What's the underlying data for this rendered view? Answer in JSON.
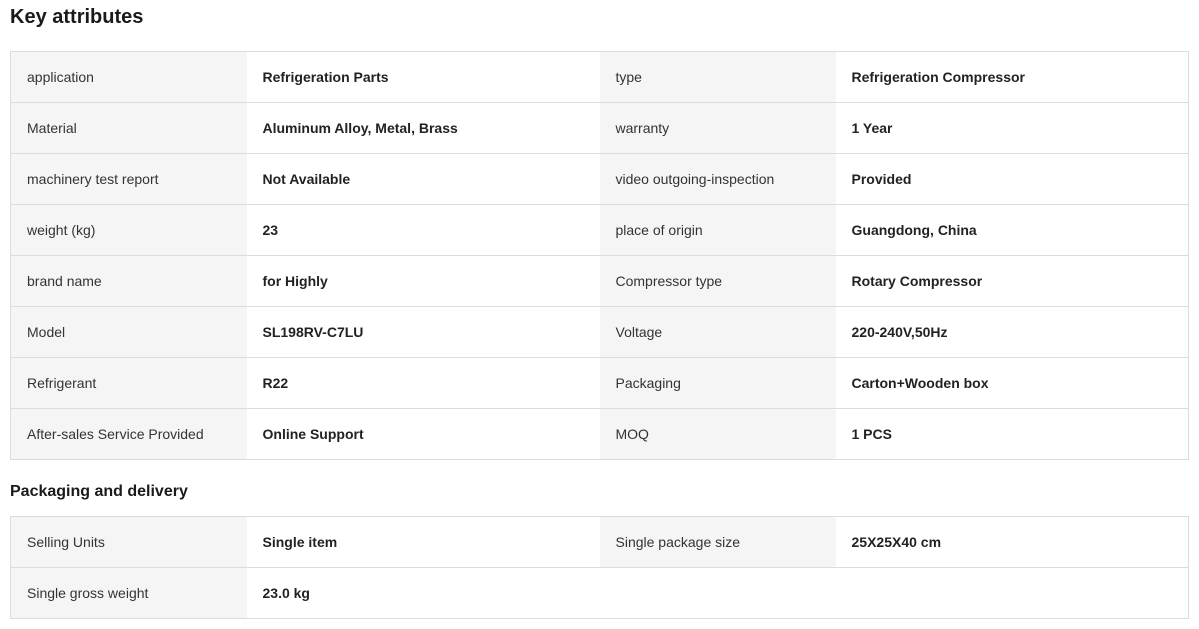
{
  "key_attributes": {
    "title": "Key attributes",
    "rows": [
      [
        {
          "label": "application",
          "value": "Refrigeration Parts"
        },
        {
          "label": "type",
          "value": "Refrigeration Compressor"
        }
      ],
      [
        {
          "label": "Material",
          "value": "Aluminum Alloy, Metal, Brass"
        },
        {
          "label": "warranty",
          "value": "1 Year"
        }
      ],
      [
        {
          "label": "machinery test report",
          "value": "Not Available"
        },
        {
          "label": "video outgoing-inspection",
          "value": "Provided"
        }
      ],
      [
        {
          "label": "weight (kg)",
          "value": "23"
        },
        {
          "label": "place of origin",
          "value": "Guangdong, China"
        }
      ],
      [
        {
          "label": "brand name",
          "value": "for Highly"
        },
        {
          "label": "Compressor type",
          "value": "Rotary Compressor"
        }
      ],
      [
        {
          "label": "Model",
          "value": "SL198RV-C7LU"
        },
        {
          "label": "Voltage",
          "value": "220-240V,50Hz"
        }
      ],
      [
        {
          "label": "Refrigerant",
          "value": "R22"
        },
        {
          "label": "Packaging",
          "value": "Carton+Wooden box"
        }
      ],
      [
        {
          "label": "After-sales Service Provided",
          "value": "Online Support"
        },
        {
          "label": "MOQ",
          "value": "1 PCS"
        }
      ]
    ]
  },
  "packaging_delivery": {
    "title": "Packaging and delivery",
    "rows": [
      [
        {
          "label": "Selling Units",
          "value": "Single item"
        },
        {
          "label": "Single package size",
          "value": "25X25X40 cm"
        }
      ],
      [
        {
          "label": "Single gross weight",
          "value": "23.0 kg"
        }
      ]
    ]
  }
}
